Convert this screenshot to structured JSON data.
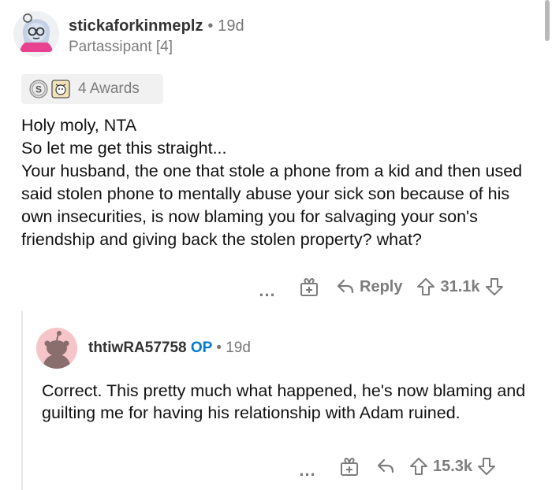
{
  "comment": {
    "username": "stickaforkinmeplz",
    "separator": "•",
    "time": "19d",
    "flair": "Partassipant [4]",
    "awards_label": "4 Awards",
    "lines": [
      "Holy moly, NTA",
      "So let me get this straight...",
      "Your husband, the one that stole a phone from a kid and then used said stolen phone to mentally abuse your sick son because of his own insecurities, is now blaming you for salvaging your son's friendship and giving back the stolen property? what?"
    ],
    "more_label": "...",
    "reply_label": "Reply",
    "score": "31.1k"
  },
  "reply": {
    "username": "thtiwRA57758",
    "op_label": "OP",
    "separator": "•",
    "time": "19d",
    "text": "Correct. This pretty much what happened, he's now blaming and guilting me for having his relationship with Adam ruined.",
    "more_label": "...",
    "score": "15.3k"
  },
  "icons": {
    "avatar": "avatar-icon",
    "award_silver": "silver-award-icon",
    "award_helpful": "helpful-award-icon",
    "gift": "gift-icon",
    "reply": "reply-arrow-icon",
    "upvote": "upvote-icon",
    "downvote": "downvote-icon"
  },
  "colors": {
    "op": "#0079d3",
    "reply_avatar_bg": "#f6c5c9",
    "meta_gray": "#7c7c7c"
  }
}
